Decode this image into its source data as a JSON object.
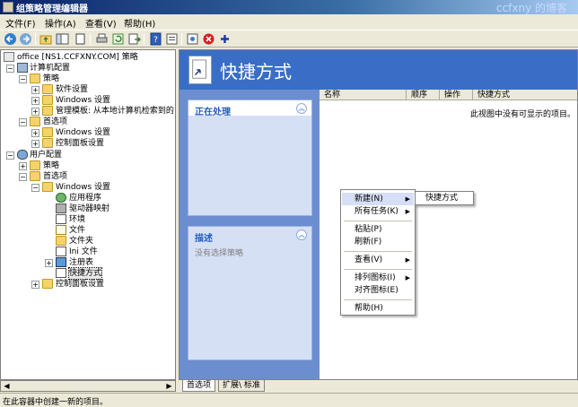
{
  "window": {
    "title": "组策略管理编辑器",
    "watermark": "ccfxny 的博客"
  },
  "menubar": {
    "items": [
      "文件(F)",
      "操作(A)",
      "查看(V)",
      "帮助(H)"
    ]
  },
  "toolbar": {
    "icons": [
      "back-icon",
      "forward-icon",
      "up-folder-icon",
      "show-hide-tree-icon",
      "delete-icon",
      "export-list-icon",
      "refresh-icon",
      "properties-icon",
      "help-icon",
      "new-window-icon",
      "new-icon",
      "stop-icon",
      "add-icon"
    ]
  },
  "tree": {
    "root": "office [NS1.CCFXNY.COM] 策略",
    "computer_config": "计算机配置",
    "cc_policies": "策略",
    "cc_software": "软件设置",
    "cc_windows": "Windows 设置",
    "cc_admin": "管理模板: 从本地计算机检索到的",
    "cc_prefs": "首选项",
    "cc_prefs_windows": "Windows 设置",
    "cc_prefs_control": "控制面板设置",
    "user_config": "用户配置",
    "uc_policies": "策略",
    "uc_prefs": "首选项",
    "uc_windows": "Windows 设置",
    "uc_apps": "应用程序",
    "uc_drive": "驱动器映射",
    "uc_env": "环境",
    "uc_files": "文件",
    "uc_folders": "文件夹",
    "uc_ini": "Ini 文件",
    "uc_registry": "注册表",
    "uc_shortcuts": "快捷方式",
    "uc_control": "控制面板设置"
  },
  "right": {
    "title": "快捷方式",
    "processing_title": "正在处理",
    "description_title": "描述",
    "description_text": "没有选择策略",
    "columns": [
      "名称",
      "顺序",
      "操作",
      "快捷方式"
    ],
    "empty_text": "此视图中没有可显示的项目。"
  },
  "context_menu": {
    "new": "新建(N)",
    "all_tasks": "所有任务(K)",
    "paste": "粘贴(P)",
    "refresh": "刷新(F)",
    "view": "查看(V)",
    "arrange": "排列图标(I)",
    "align": "对齐图标(E)",
    "help": "帮助(H)",
    "submenu_item": "快捷方式"
  },
  "tabs": {
    "active": "首选项",
    "inactive": "扩展\\ 标准"
  },
  "status": {
    "text": "在此容器中创建一新的项目。"
  },
  "colors": {
    "header_blue": "#3a6ec6",
    "taskpane_blue": "#6b8ed1",
    "title_accent": "#215dc6"
  }
}
